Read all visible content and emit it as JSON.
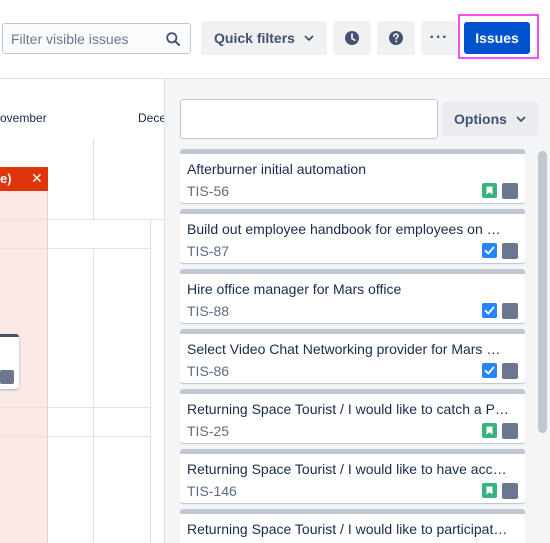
{
  "toolbar": {
    "filter_placeholder": "Filter visible issues",
    "quick_filters_label": "Quick filters",
    "more_label": "···",
    "issues_label": "Issues"
  },
  "timeline": {
    "months": [
      "ovember",
      "Dece"
    ],
    "red_header_text": "e)",
    "red_header_close": "✕"
  },
  "panel": {
    "search_value": "",
    "options_label": "Options",
    "issues": [
      {
        "title": "Afterburner initial automation",
        "key": "TIS-56",
        "type": "story"
      },
      {
        "title": "Build out employee handbook for employees on …",
        "key": "TIS-87",
        "type": "task"
      },
      {
        "title": "Hire office manager for Mars office",
        "key": "TIS-88",
        "type": "task"
      },
      {
        "title": "Select Video Chat Networking provider for Mars …",
        "key": "TIS-86",
        "type": "task"
      },
      {
        "title": "Returning Space Tourist / I would like to catch a P…",
        "key": "TIS-25",
        "type": "story"
      },
      {
        "title": "Returning Space Tourist / I would like to have acc…",
        "key": "TIS-146",
        "type": "story"
      },
      {
        "title": "Returning Space Tourist / I would like to participat…",
        "key": "",
        "type": "story"
      }
    ]
  },
  "colors": {
    "primary": "#0052cc",
    "highlight": "#f54ef0",
    "story": "#36b37e",
    "task": "#2684ff",
    "danger": "#de350b"
  }
}
